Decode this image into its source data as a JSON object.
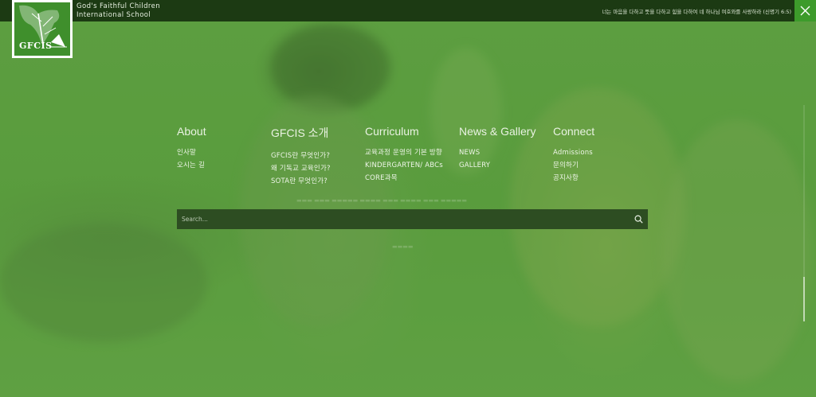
{
  "header": {
    "logo_text": "GFCIS",
    "school_name_line1": "God's Faithful Children",
    "school_name_line2": "International School",
    "verse": "너는 마음을 다하고 뜻을 다하고 힘을 다하여 네 하나님 여호와를 사랑하라 (신명기 6:5)",
    "close_icon": "close-icon"
  },
  "nav": {
    "columns": [
      {
        "title": "About",
        "items": [
          "인사말",
          "오시는 길"
        ]
      },
      {
        "title": "GFCIS 소개",
        "items": [
          "GFCIS란 무엇인가?",
          "왜 기독교 교육인가?",
          "SOTA란 무엇인가?"
        ]
      },
      {
        "title": "Curriculum",
        "items": [
          "교육과정 운영의 기본 방향",
          "KINDERGARTEN/ ABCs",
          "CORE과목"
        ]
      },
      {
        "title": "News & Gallery",
        "items": [
          "NEWS",
          "GALLERY"
        ]
      },
      {
        "title": "Connect",
        "items": [
          "Admissions",
          "문의하기",
          "공지사항"
        ]
      }
    ]
  },
  "search": {
    "placeholder": "Search...",
    "icon": "search-icon"
  },
  "colors": {
    "topbar": "#1c3a13",
    "accent": "#3d9b2b",
    "search_bg": "#2d4d22"
  }
}
